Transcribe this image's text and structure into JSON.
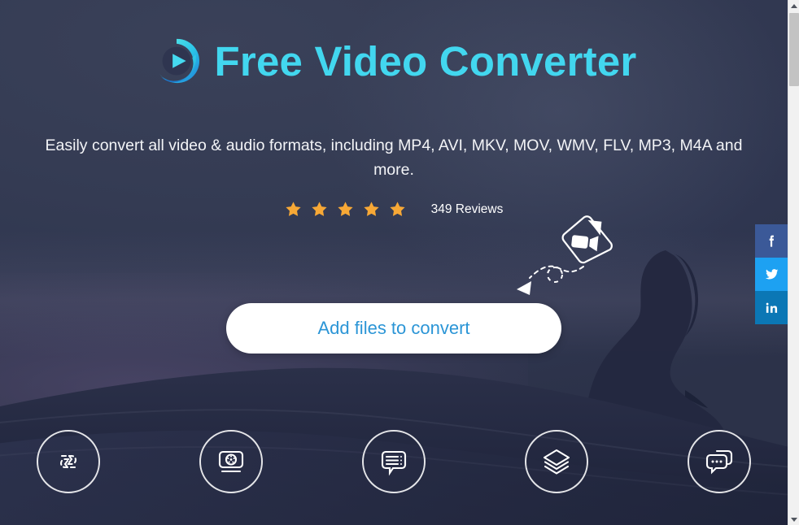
{
  "brand": {
    "logo_icon": "play-circle-logo",
    "title": "Free Video Converter"
  },
  "hero": {
    "subtitle": "Easily convert all video & audio formats, including MP4, AVI, MKV, MOV, WMV, FLV, MP3, M4A and more.",
    "cta_label": "Add files to convert",
    "drop_hint_icon": "video-file-drag-arrow"
  },
  "rating": {
    "stars_filled": 5,
    "star_icon": "star-icon",
    "star_color": "#f7a836",
    "reviews_label": "349 Reviews"
  },
  "features": [
    {
      "icon": "convert-arrows-icon",
      "name": "convert"
    },
    {
      "icon": "dvd-screen-icon",
      "name": "dvd"
    },
    {
      "icon": "subtitle-bubble-icon",
      "name": "subtitle"
    },
    {
      "icon": "layers-stack-icon",
      "name": "batch"
    },
    {
      "icon": "chat-bubbles-icon",
      "name": "support"
    }
  ],
  "social": [
    {
      "name": "facebook",
      "icon": "facebook-icon",
      "color": "#3b5998"
    },
    {
      "name": "twitter",
      "icon": "twitter-icon",
      "color": "#1da1f2"
    },
    {
      "name": "linkedin",
      "icon": "linkedin-icon",
      "color": "#0b77b5"
    }
  ],
  "theme": {
    "title_color": "#42d7ef",
    "cta_text_color": "#2b95d6",
    "cta_bg_color": "#ffffff",
    "background_color": "#343b53"
  },
  "scrollbar": {
    "up_arrow": "scroll-up-arrow",
    "down_arrow": "scroll-down-arrow"
  }
}
